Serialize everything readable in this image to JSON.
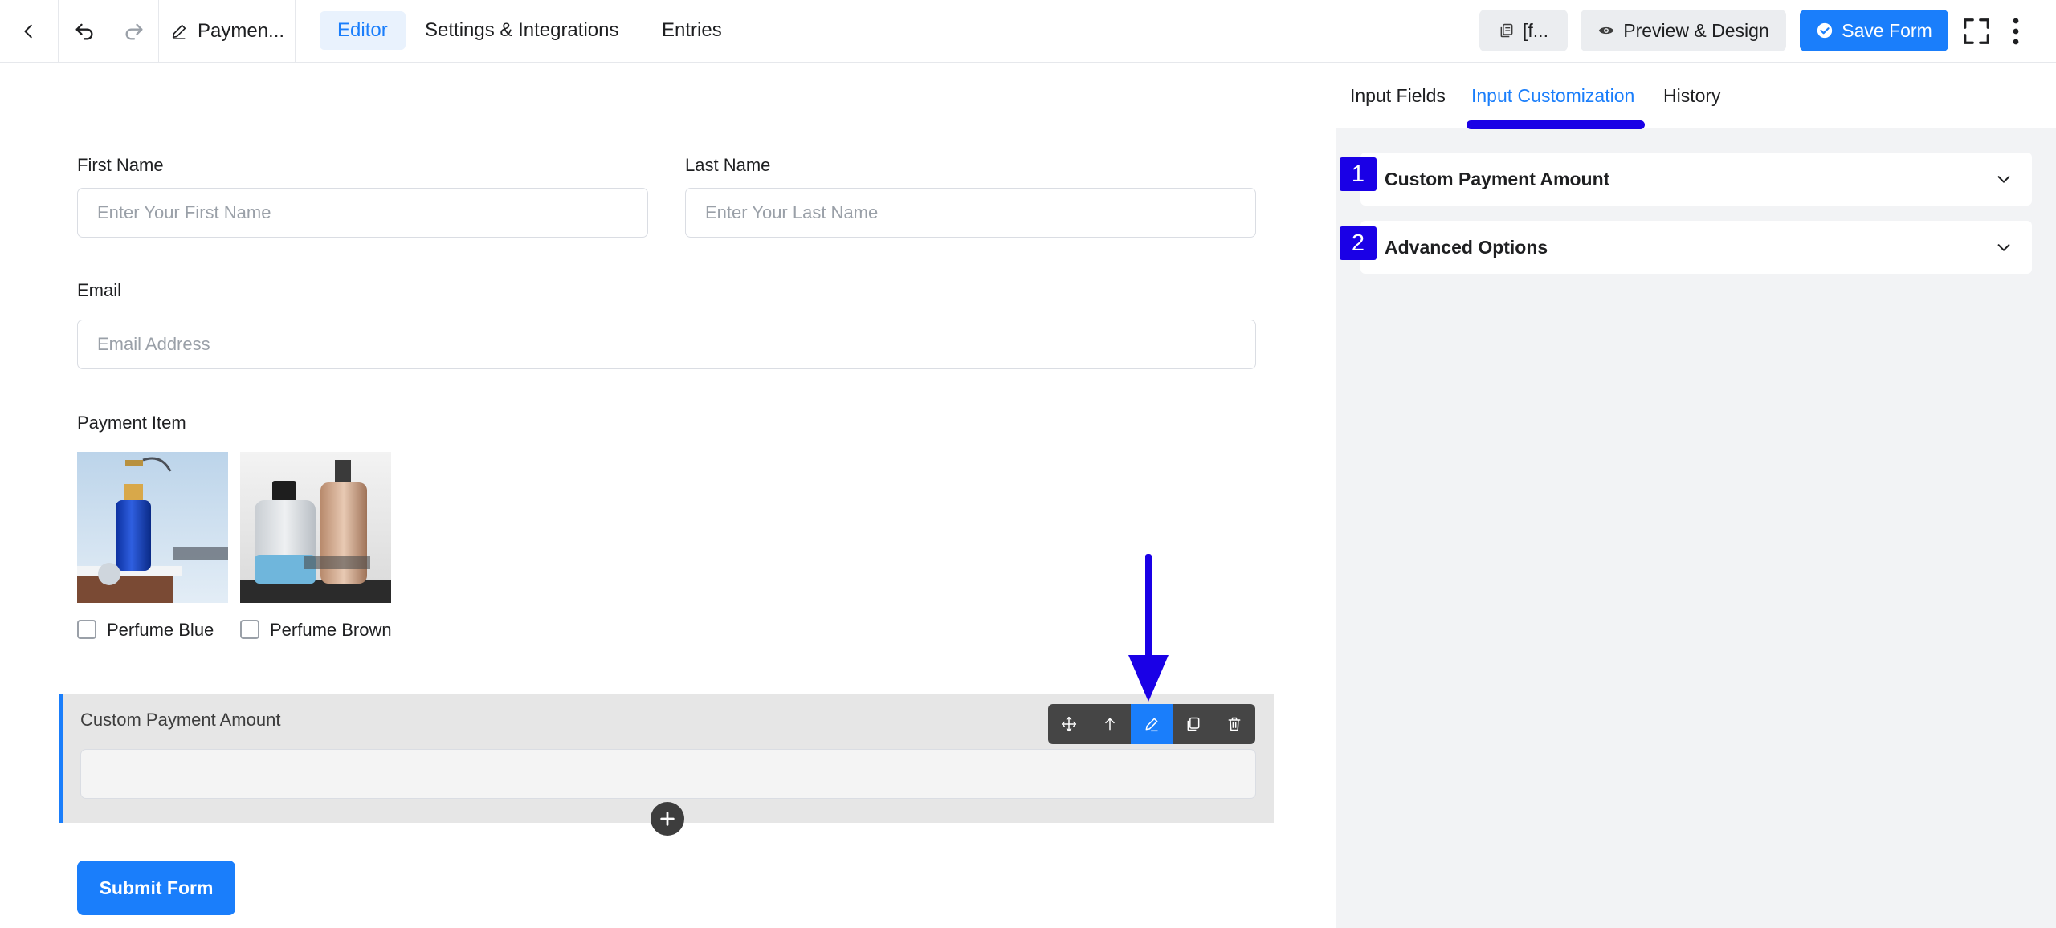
{
  "topbar": {
    "form_name": "Paymen...",
    "tabs": [
      {
        "label": "Editor",
        "active": true
      },
      {
        "label": "Settings & Integrations",
        "active": false
      },
      {
        "label": "Entries",
        "active": false
      }
    ],
    "shortcode_label": "[f...",
    "preview_label": "Preview & Design",
    "save_label": "Save Form"
  },
  "form": {
    "first_name": {
      "label": "First Name",
      "placeholder": "Enter Your First Name"
    },
    "last_name": {
      "label": "Last Name",
      "placeholder": "Enter Your Last Name"
    },
    "email": {
      "label": "Email",
      "placeholder": "Email Address"
    },
    "payment_item": {
      "label": "Payment Item",
      "options": [
        {
          "label": "Perfume Blue"
        },
        {
          "label": "Perfume Brown"
        }
      ]
    },
    "custom_amount": {
      "label": "Custom Payment Amount"
    },
    "submit_label": "Submit Form"
  },
  "sidebar": {
    "tabs": [
      {
        "label": "Input Fields",
        "active": false
      },
      {
        "label": "Input Customization",
        "active": true
      },
      {
        "label": "History",
        "active": false
      }
    ],
    "accordions": [
      {
        "badge": "1",
        "title": "Custom Payment Amount"
      },
      {
        "badge": "2",
        "title": "Advanced Options"
      }
    ]
  },
  "colors": {
    "accent": "#1a7efb",
    "annotation": "#1a00e6"
  }
}
